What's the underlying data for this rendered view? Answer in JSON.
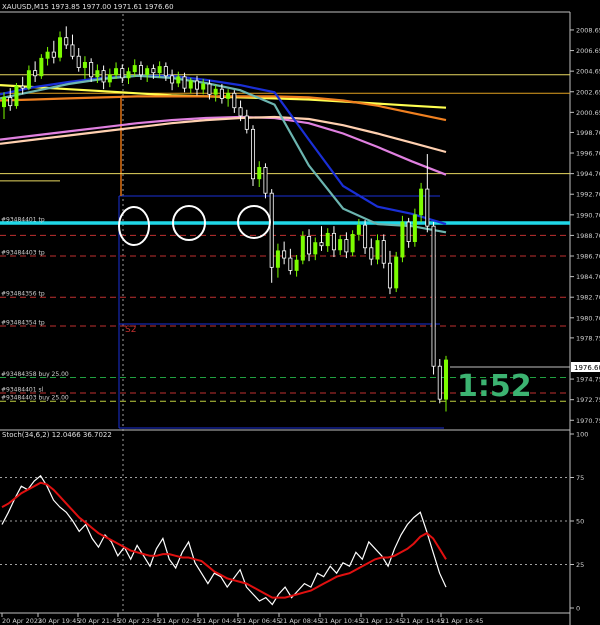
{
  "header": {
    "symbol": "XAUUSD,M15",
    "ohlc": "1973.85 1977.00 1971.61 1976.60"
  },
  "stoch_header": "Stoch(34,6,2) 12.0466 36.7022",
  "price_tag": "1976.60",
  "ratio_text": "1:52",
  "s2_label": "S2",
  "colors": {
    "background": "#000000",
    "axis": "#c0c0c0",
    "bull_candle": "#7CFC00",
    "bear_candle": "#ffffff",
    "ma_blue": "#1a2fd6",
    "ma_teal": "#6cb5b0",
    "ma_yellow": "#ffff50",
    "ma_orange": "#f08020",
    "ma_pink": "#e080e0",
    "ma_peach": "#ffd0b0",
    "cyan_level": "#20d8e8",
    "stoch_main": "#ffffff",
    "stoch_signal": "#e01010",
    "ratio_green": "#3cb371"
  },
  "chart_data": [
    {
      "type": "candlestick",
      "title": "XAUUSD,M15",
      "price_axis_ticks": [
        2008.65,
        2006.65,
        2004.65,
        2002.65,
        2000.65,
        1998.7,
        1996.7,
        1994.7,
        1992.7,
        1990.7,
        1988.7,
        1986.7,
        1984.7,
        1982.7,
        1980.7,
        1978.75,
        1976.6,
        1974.75,
        1972.75,
        1970.75
      ],
      "ylim": [
        1970.0,
        2010.2
      ],
      "candles": [
        [
          2001.2,
          2002.6,
          2000.0,
          2002.1
        ],
        [
          2002.1,
          2003.0,
          2000.8,
          2001.3
        ],
        [
          2001.3,
          2003.5,
          2001.0,
          2003.2
        ],
        [
          2003.2,
          2004.1,
          2002.4,
          2003.0
        ],
        [
          2003.0,
          2005.2,
          2002.8,
          2004.7
        ],
        [
          2004.7,
          2005.6,
          2003.6,
          2004.2
        ],
        [
          2004.2,
          2006.3,
          2003.9,
          2005.9
        ],
        [
          2005.9,
          2007.0,
          2005.2,
          2006.5
        ],
        [
          2006.5,
          2007.6,
          2005.4,
          2006.0
        ],
        [
          2006.0,
          2008.5,
          2005.6,
          2007.9
        ],
        [
          2007.9,
          2009.0,
          2006.8,
          2007.2
        ],
        [
          2007.2,
          2008.2,
          2005.8,
          2006.1
        ],
        [
          2006.1,
          2006.9,
          2004.6,
          2005.0
        ],
        [
          2005.0,
          2006.1,
          2003.9,
          2005.5
        ],
        [
          2005.5,
          2005.9,
          2003.6,
          2004.1
        ],
        [
          2004.1,
          2005.3,
          2003.5,
          2004.7
        ],
        [
          2004.7,
          2005.2,
          2002.9,
          2003.6
        ],
        [
          2003.6,
          2004.9,
          2003.1,
          2004.3
        ],
        [
          2004.3,
          2005.5,
          2003.9,
          2004.9
        ],
        [
          2004.9,
          2005.3,
          2003.5,
          2004.0
        ],
        [
          2004.0,
          2005.0,
          2003.4,
          2004.6
        ],
        [
          2004.6,
          2005.8,
          2004.1,
          2005.2
        ],
        [
          2005.2,
          2005.6,
          2003.8,
          2004.3
        ],
        [
          2004.3,
          2005.2,
          2003.6,
          2004.9
        ],
        [
          2004.9,
          2005.3,
          2003.9,
          2004.5
        ],
        [
          2004.5,
          2005.6,
          2004.0,
          2005.1
        ],
        [
          2005.1,
          2005.5,
          2003.7,
          2004.2
        ],
        [
          2004.2,
          2004.8,
          2002.8,
          2003.5
        ],
        [
          2003.5,
          2004.6,
          2003.1,
          2004.1
        ],
        [
          2004.1,
          2004.5,
          2002.6,
          2003.0
        ],
        [
          2003.0,
          2004.0,
          2002.5,
          2003.7
        ],
        [
          2003.7,
          2004.2,
          2002.3,
          2002.9
        ],
        [
          2002.9,
          2003.9,
          2002.4,
          2003.4
        ],
        [
          2003.4,
          2003.8,
          2001.9,
          2002.4
        ],
        [
          2002.4,
          2003.3,
          2001.7,
          2002.9
        ],
        [
          2002.9,
          2003.4,
          2001.5,
          2002.0
        ],
        [
          2002.0,
          2002.9,
          2001.2,
          2002.5
        ],
        [
          2002.5,
          2002.8,
          2000.6,
          2001.1
        ],
        [
          2001.1,
          2001.8,
          1999.8,
          2000.3
        ],
        [
          2000.3,
          2000.9,
          1998.6,
          1999.0
        ],
        [
          1999.0,
          1999.4,
          1993.5,
          1994.2
        ],
        [
          1994.2,
          1995.9,
          1993.4,
          1995.3
        ],
        [
          1995.3,
          1995.7,
          1992.3,
          1992.8
        ],
        [
          1992.8,
          1993.2,
          1984.1,
          1985.6
        ],
        [
          1985.6,
          1987.9,
          1984.6,
          1987.2
        ],
        [
          1987.2,
          1988.1,
          1985.9,
          1986.5
        ],
        [
          1986.5,
          1987.4,
          1984.9,
          1985.3
        ],
        [
          1985.3,
          1986.8,
          1984.7,
          1986.3
        ],
        [
          1986.3,
          1989.1,
          1985.9,
          1988.6
        ],
        [
          1988.6,
          1989.3,
          1986.2,
          1986.9
        ],
        [
          1986.9,
          1988.5,
          1986.3,
          1988.0
        ],
        [
          1988.0,
          1989.6,
          1987.2,
          1987.7
        ],
        [
          1987.7,
          1989.4,
          1987.1,
          1988.9
        ],
        [
          1988.9,
          1989.6,
          1986.6,
          1987.3
        ],
        [
          1987.3,
          1988.7,
          1986.8,
          1988.3
        ],
        [
          1988.3,
          1989.0,
          1986.5,
          1987.1
        ],
        [
          1987.1,
          1989.2,
          1986.7,
          1988.8
        ],
        [
          1988.8,
          1990.3,
          1988.2,
          1989.7
        ],
        [
          1989.7,
          1990.2,
          1986.9,
          1987.5
        ],
        [
          1987.5,
          1988.4,
          1985.8,
          1986.4
        ],
        [
          1986.4,
          1988.8,
          1985.9,
          1988.2
        ],
        [
          1988.2,
          1988.8,
          1985.5,
          1986.0
        ],
        [
          1986.0,
          1987.2,
          1983.0,
          1983.6
        ],
        [
          1983.6,
          1987.1,
          1983.2,
          1986.6
        ],
        [
          1986.6,
          1990.6,
          1986.1,
          1990.0
        ],
        [
          1990.0,
          1990.4,
          1987.5,
          1988.1
        ],
        [
          1988.1,
          1991.3,
          1987.6,
          1990.7
        ],
        [
          1990.7,
          1993.8,
          1990.0,
          1993.2
        ],
        [
          1993.2,
          1996.6,
          1989.0,
          1989.6
        ],
        [
          1989.6,
          1990.0,
          1975.2,
          1976.0
        ],
        [
          1976.0,
          1976.7,
          1972.4,
          1972.8
        ],
        [
          1972.8,
          1977.0,
          1971.6,
          1976.6
        ]
      ],
      "moving_averages": [
        {
          "color": "ma_yellow",
          "values": [
            2003.3,
            2003.1,
            2002.9,
            2002.7,
            2002.5,
            2002.3,
            2002.2,
            2002.1,
            2002.0,
            2001.9,
            2001.7,
            2001.5,
            2001.3,
            2001.1
          ]
        },
        {
          "color": "ma_orange",
          "values": [
            2001.8,
            2001.9,
            2002.0,
            2002.1,
            2002.2,
            2002.2,
            2002.2,
            2002.2,
            2002.2,
            2002.1,
            2001.8,
            2001.3,
            2000.6,
            1999.9
          ]
        },
        {
          "color": "ma_pink",
          "values": [
            1998.0,
            1998.4,
            1998.8,
            1999.2,
            1999.6,
            1999.9,
            2000.1,
            2000.2,
            2000.1,
            1999.6,
            1998.6,
            1997.3,
            1995.9,
            1994.6
          ]
        },
        {
          "color": "ma_peach",
          "values": [
            1997.6,
            1998.0,
            1998.4,
            1998.8,
            1999.2,
            1999.6,
            1999.9,
            2000.1,
            2000.2,
            2000.0,
            1999.4,
            1998.6,
            1997.7,
            1996.8
          ]
        },
        {
          "color": "ma_blue",
          "values": [
            2002.4,
            2003.1,
            2003.6,
            2004.0,
            2004.2,
            2004.2,
            2003.8,
            2003.3,
            2002.6,
            1998.0,
            1993.5,
            1991.5,
            1990.8,
            1989.8
          ]
        },
        {
          "color": "ma_teal",
          "values": [
            2002.0,
            2002.7,
            2003.4,
            2003.9,
            2004.2,
            2004.0,
            2003.5,
            2002.8,
            2001.4,
            1995.5,
            1991.3,
            1989.8,
            1989.6,
            1989.0
          ]
        }
      ],
      "levels": [
        {
          "price": 2004.3,
          "color": "#e8d860",
          "dash": false
        },
        {
          "price": 2002.5,
          "color": "#e0a020",
          "dash": false
        },
        {
          "price": 1994.7,
          "color": "#e8d860",
          "dash": false
        },
        {
          "price": 1989.9,
          "color": "cyan_level",
          "dash": false,
          "label": "#93484401 tp"
        },
        {
          "price": 1988.7,
          "color": "#c03030",
          "dash": true
        },
        {
          "price": 1986.7,
          "color": "#c03030",
          "dash": true,
          "label": "#93484403 tp"
        },
        {
          "price": 1982.7,
          "color": "#c03030",
          "dash": true,
          "label": "#93484356 tp"
        },
        {
          "price": 1979.9,
          "color": "#c03030",
          "dash": true,
          "label": "#93484354 tp"
        },
        {
          "price": 1974.9,
          "color": "#20a040",
          "dash": true,
          "label": "#93484358 buy 25.00"
        },
        {
          "price": 1973.4,
          "color": "#c03030",
          "dash": true,
          "label": "#93484401 sl"
        },
        {
          "price": 1972.6,
          "color": "#c0d040",
          "dash": true,
          "label": "#93484403 buy 25.00"
        }
      ]
    },
    {
      "type": "line",
      "title": "Stoch(34,6,2) 12.0466 36.7022",
      "ylim": [
        0,
        100
      ],
      "y_ticks": [
        100,
        75,
        50,
        25,
        0
      ],
      "x_tick_labels": [
        "20 Apr 2023",
        "20 Apr 19:45",
        "20 Apr 21:45",
        "20 Apr 23:45",
        "21 Apr 02:45",
        "21 Apr 04:45",
        "21 Apr 06:45",
        "21 Apr 08:45",
        "21 Apr 10:45",
        "21 Apr 12:45",
        "21 Apr 14:45",
        "21 Apr 16:45"
      ],
      "series": [
        {
          "color": "stoch_main",
          "values": [
            48,
            55,
            63,
            70,
            68,
            73,
            76,
            70,
            62,
            58,
            55,
            50,
            44,
            48,
            40,
            35,
            42,
            38,
            30,
            35,
            28,
            36,
            30,
            24,
            34,
            40,
            28,
            23,
            32,
            38,
            26,
            20,
            14,
            20,
            18,
            12,
            17,
            22,
            12,
            8,
            4,
            6,
            2,
            8,
            12,
            6,
            10,
            14,
            12,
            20,
            18,
            24,
            20,
            26,
            24,
            32,
            28,
            38,
            34,
            30,
            24,
            34,
            42,
            48,
            52,
            55,
            44,
            32,
            20,
            12
          ]
        },
        {
          "color": "stoch_signal",
          "values": [
            58,
            60,
            63,
            66,
            68,
            70,
            72,
            71,
            68,
            64,
            60,
            56,
            52,
            49,
            46,
            43,
            41,
            39,
            37,
            35,
            33,
            32,
            31,
            30,
            30,
            31,
            31,
            30,
            29,
            29,
            28,
            27,
            24,
            21,
            19,
            17,
            16,
            15,
            14,
            12,
            10,
            8,
            6,
            6,
            6,
            7,
            8,
            9,
            10,
            12,
            14,
            16,
            18,
            19,
            20,
            22,
            24,
            26,
            28,
            29,
            29,
            30,
            32,
            34,
            37,
            41,
            43,
            40,
            34,
            28
          ]
        }
      ]
    }
  ]
}
